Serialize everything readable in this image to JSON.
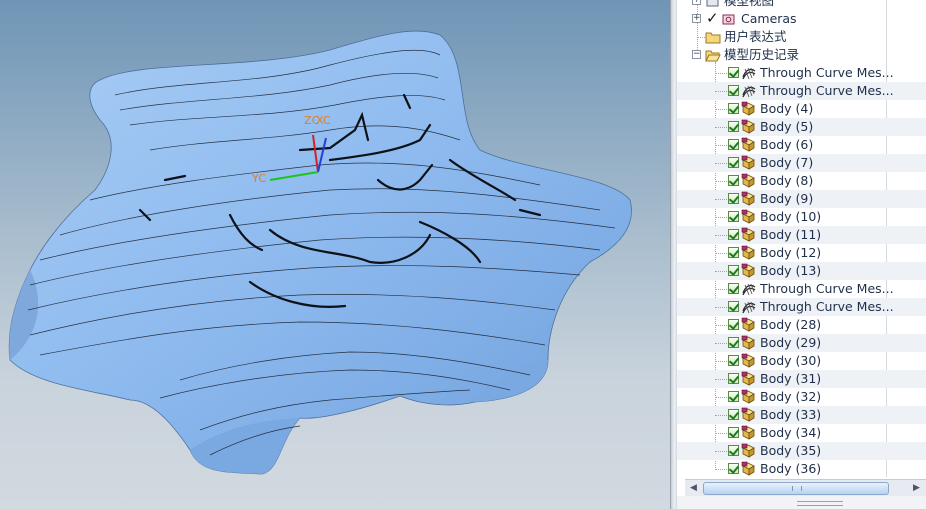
{
  "viewport": {
    "wcs_labels": {
      "zc": "ZC",
      "xc": "XC",
      "yc": "YC"
    },
    "surface_color": "#8fbbef",
    "background_top": "#6f95b6",
    "background_bottom": "#d2d9e0"
  },
  "navigator": {
    "top_nodes": [
      {
        "label": "模型视图",
        "icon": "model-views-icon"
      },
      {
        "label": "Cameras",
        "icon": "camera-icon"
      },
      {
        "label": "用户表达式",
        "icon": "folder-icon"
      },
      {
        "label": "模型历史记录",
        "icon": "open-folder-icon"
      }
    ],
    "history_items": [
      {
        "label": "Through Curve Mes...",
        "icon": "through-curve-mesh-icon"
      },
      {
        "label": "Through Curve Mes...",
        "icon": "through-curve-mesh-icon"
      },
      {
        "label": "Body (4)",
        "icon": "body-icon"
      },
      {
        "label": "Body (5)",
        "icon": "body-icon"
      },
      {
        "label": "Body (6)",
        "icon": "body-icon"
      },
      {
        "label": "Body (7)",
        "icon": "body-icon"
      },
      {
        "label": "Body (8)",
        "icon": "body-icon"
      },
      {
        "label": "Body (9)",
        "icon": "body-icon"
      },
      {
        "label": "Body (10)",
        "icon": "body-icon"
      },
      {
        "label": "Body (11)",
        "icon": "body-icon"
      },
      {
        "label": "Body (12)",
        "icon": "body-icon"
      },
      {
        "label": "Body (13)",
        "icon": "body-icon"
      },
      {
        "label": "Through Curve Mes...",
        "icon": "through-curve-mesh-icon"
      },
      {
        "label": "Through Curve Mes...",
        "icon": "through-curve-mesh-icon"
      },
      {
        "label": "Body (28)",
        "icon": "body-icon"
      },
      {
        "label": "Body (29)",
        "icon": "body-icon"
      },
      {
        "label": "Body (30)",
        "icon": "body-icon"
      },
      {
        "label": "Body (31)",
        "icon": "body-icon"
      },
      {
        "label": "Body (32)",
        "icon": "body-icon"
      },
      {
        "label": "Body (33)",
        "icon": "body-icon"
      },
      {
        "label": "Body (34)",
        "icon": "body-icon"
      },
      {
        "label": "Body (35)",
        "icon": "body-icon"
      },
      {
        "label": "Body (36)",
        "icon": "body-icon"
      }
    ],
    "scrollbar": {
      "left_arrow": "◀",
      "right_arrow": "▶"
    }
  }
}
